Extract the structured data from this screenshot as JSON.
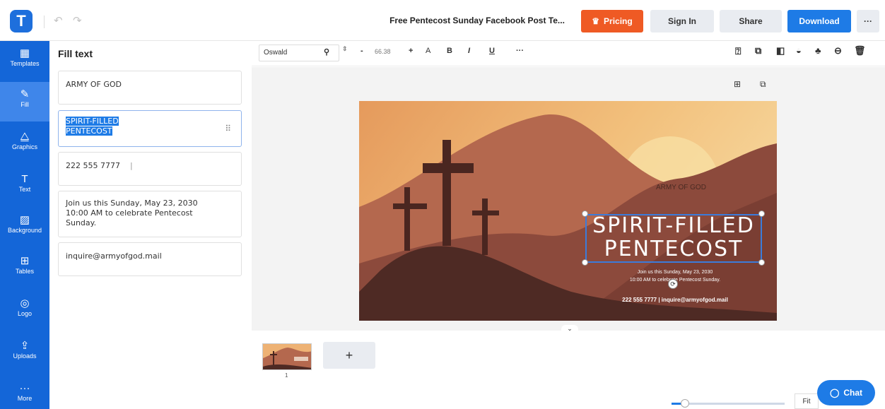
{
  "app": {
    "logo_letter": "T",
    "title": "Free Pentecost Sunday Facebook Post Te..."
  },
  "header": {
    "undo_icon": "↶",
    "redo_icon": "↷",
    "pricing": "Pricing",
    "signin": "Sign In",
    "share": "Share",
    "download": "Download",
    "more": "···"
  },
  "nav": [
    {
      "label": "Templates",
      "icon": "▦"
    },
    {
      "label": "Fill",
      "icon": "✎"
    },
    {
      "label": "Graphics",
      "icon": "⧋"
    },
    {
      "label": "Text",
      "icon": "T"
    },
    {
      "label": "Background",
      "icon": "▨"
    },
    {
      "label": "Tables",
      "icon": "⊞"
    },
    {
      "label": "Logo",
      "icon": "◎"
    },
    {
      "label": "Uploads",
      "icon": "⇪"
    },
    {
      "label": "More",
      "icon": "···"
    }
  ],
  "panel": {
    "title": "Fill text",
    "fields": [
      "ARMY OF GOD",
      "SPIRIT-FILLED",
      "PENTECOST",
      "222 555 7777",
      "Join us this Sunday, May 23, 2030",
      "10:00 AM to celebrate Pentecost",
      "Sunday.",
      "inquire@armyofgod.mail"
    ]
  },
  "toolbar": {
    "font": "Oswald",
    "size": "66.38",
    "minus": "-",
    "plus": "+",
    "a_label": "A",
    "bold": "B",
    "italic": "I",
    "underline": "U",
    "more": "···"
  },
  "design": {
    "army": "ARMY OF GOD",
    "headline1": "SPIRIT-FILLED",
    "headline2": "PENTECOST",
    "line1": "Join us this Sunday, May 23, 2030",
    "line2": "10:00 AM to celebrate Pentecost Sunday.",
    "contact": "222 555 7777   |   inquire@armyofgod.mail"
  },
  "pages": {
    "page_number": "1",
    "add": "+"
  },
  "footer": {
    "fit": "Fit",
    "chat": "Chat",
    "zoom_fraction": 0.12
  }
}
